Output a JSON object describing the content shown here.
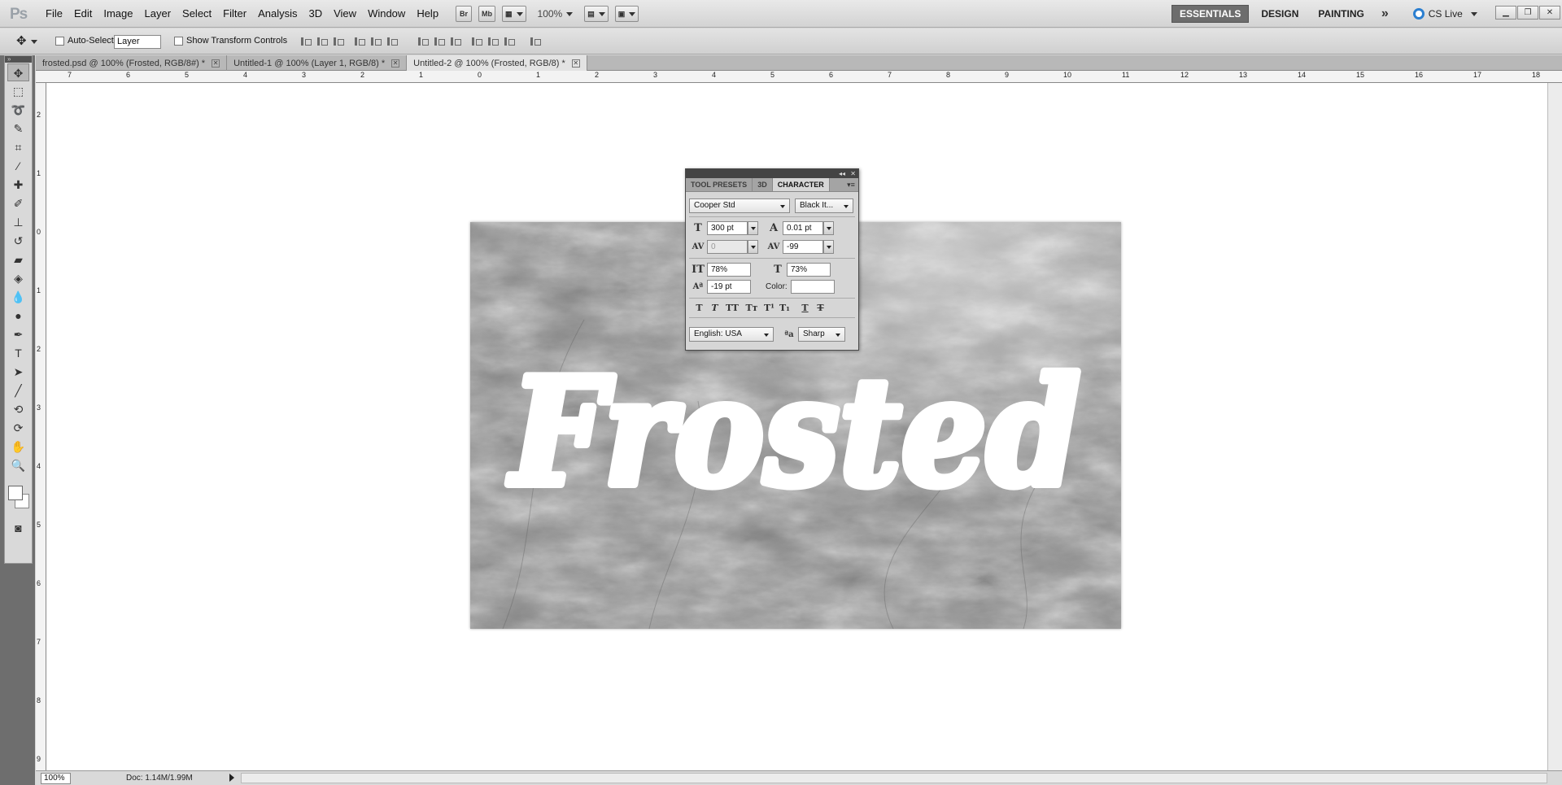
{
  "app": {
    "logo": "Ps",
    "menus": [
      "File",
      "Edit",
      "Image",
      "Layer",
      "Select",
      "Filter",
      "Analysis",
      "3D",
      "View",
      "Window",
      "Help"
    ],
    "bridge_btn": "Br",
    "minibridge_btn": "Mb",
    "zoom": "100%",
    "workspaces": [
      "ESSENTIALS",
      "DESIGN",
      "PAINTING"
    ],
    "active_workspace": "ESSENTIALS",
    "cs_live": "CS Live"
  },
  "options": {
    "auto_select_label": "Auto-Select:",
    "auto_select_value": "Layer",
    "show_transform_label": "Show Transform Controls"
  },
  "tabs": [
    {
      "label": "frosted.psd @ 100% (Frosted, RGB/8#) *"
    },
    {
      "label": "Untitled-1 @ 100% (Layer 1, RGB/8) *"
    },
    {
      "label": "Untitled-2 @ 100% (Frosted, RGB/8) *"
    }
  ],
  "ruler": {
    "top": [
      "7",
      "6",
      "5",
      "4",
      "3",
      "2",
      "1",
      "0",
      "1",
      "2",
      "3",
      "4",
      "5",
      "6",
      "7",
      "8",
      "9",
      "10",
      "11",
      "12",
      "13",
      "14",
      "15",
      "16",
      "17",
      "18"
    ],
    "left": [
      "2",
      "1",
      "0",
      "1",
      "2",
      "3",
      "4",
      "5",
      "6",
      "7",
      "8",
      "9"
    ]
  },
  "artwork": {
    "text": "Frosted"
  },
  "character_panel": {
    "tabs": [
      "TOOL PRESETS",
      "3D",
      "CHARACTER"
    ],
    "active_tab": "CHARACTER",
    "font_family": "Cooper Std",
    "font_style": "Black It...",
    "font_size": "300 pt",
    "leading": "0.01 pt",
    "kerning": "0",
    "tracking": "-99",
    "vertical_scale": "78%",
    "horizontal_scale": "73%",
    "baseline_shift": "-19 pt",
    "color_label": "Color:",
    "color_value": "#ffffff",
    "language": "English: USA",
    "antialias": "Sharp",
    "style_buttons": [
      "T",
      "T",
      "TT",
      "Tт",
      "T¹",
      "T₁",
      "T",
      "T"
    ]
  },
  "status": {
    "zoom": "100%",
    "doc_info": "Doc: 1.14M/1.99M"
  }
}
